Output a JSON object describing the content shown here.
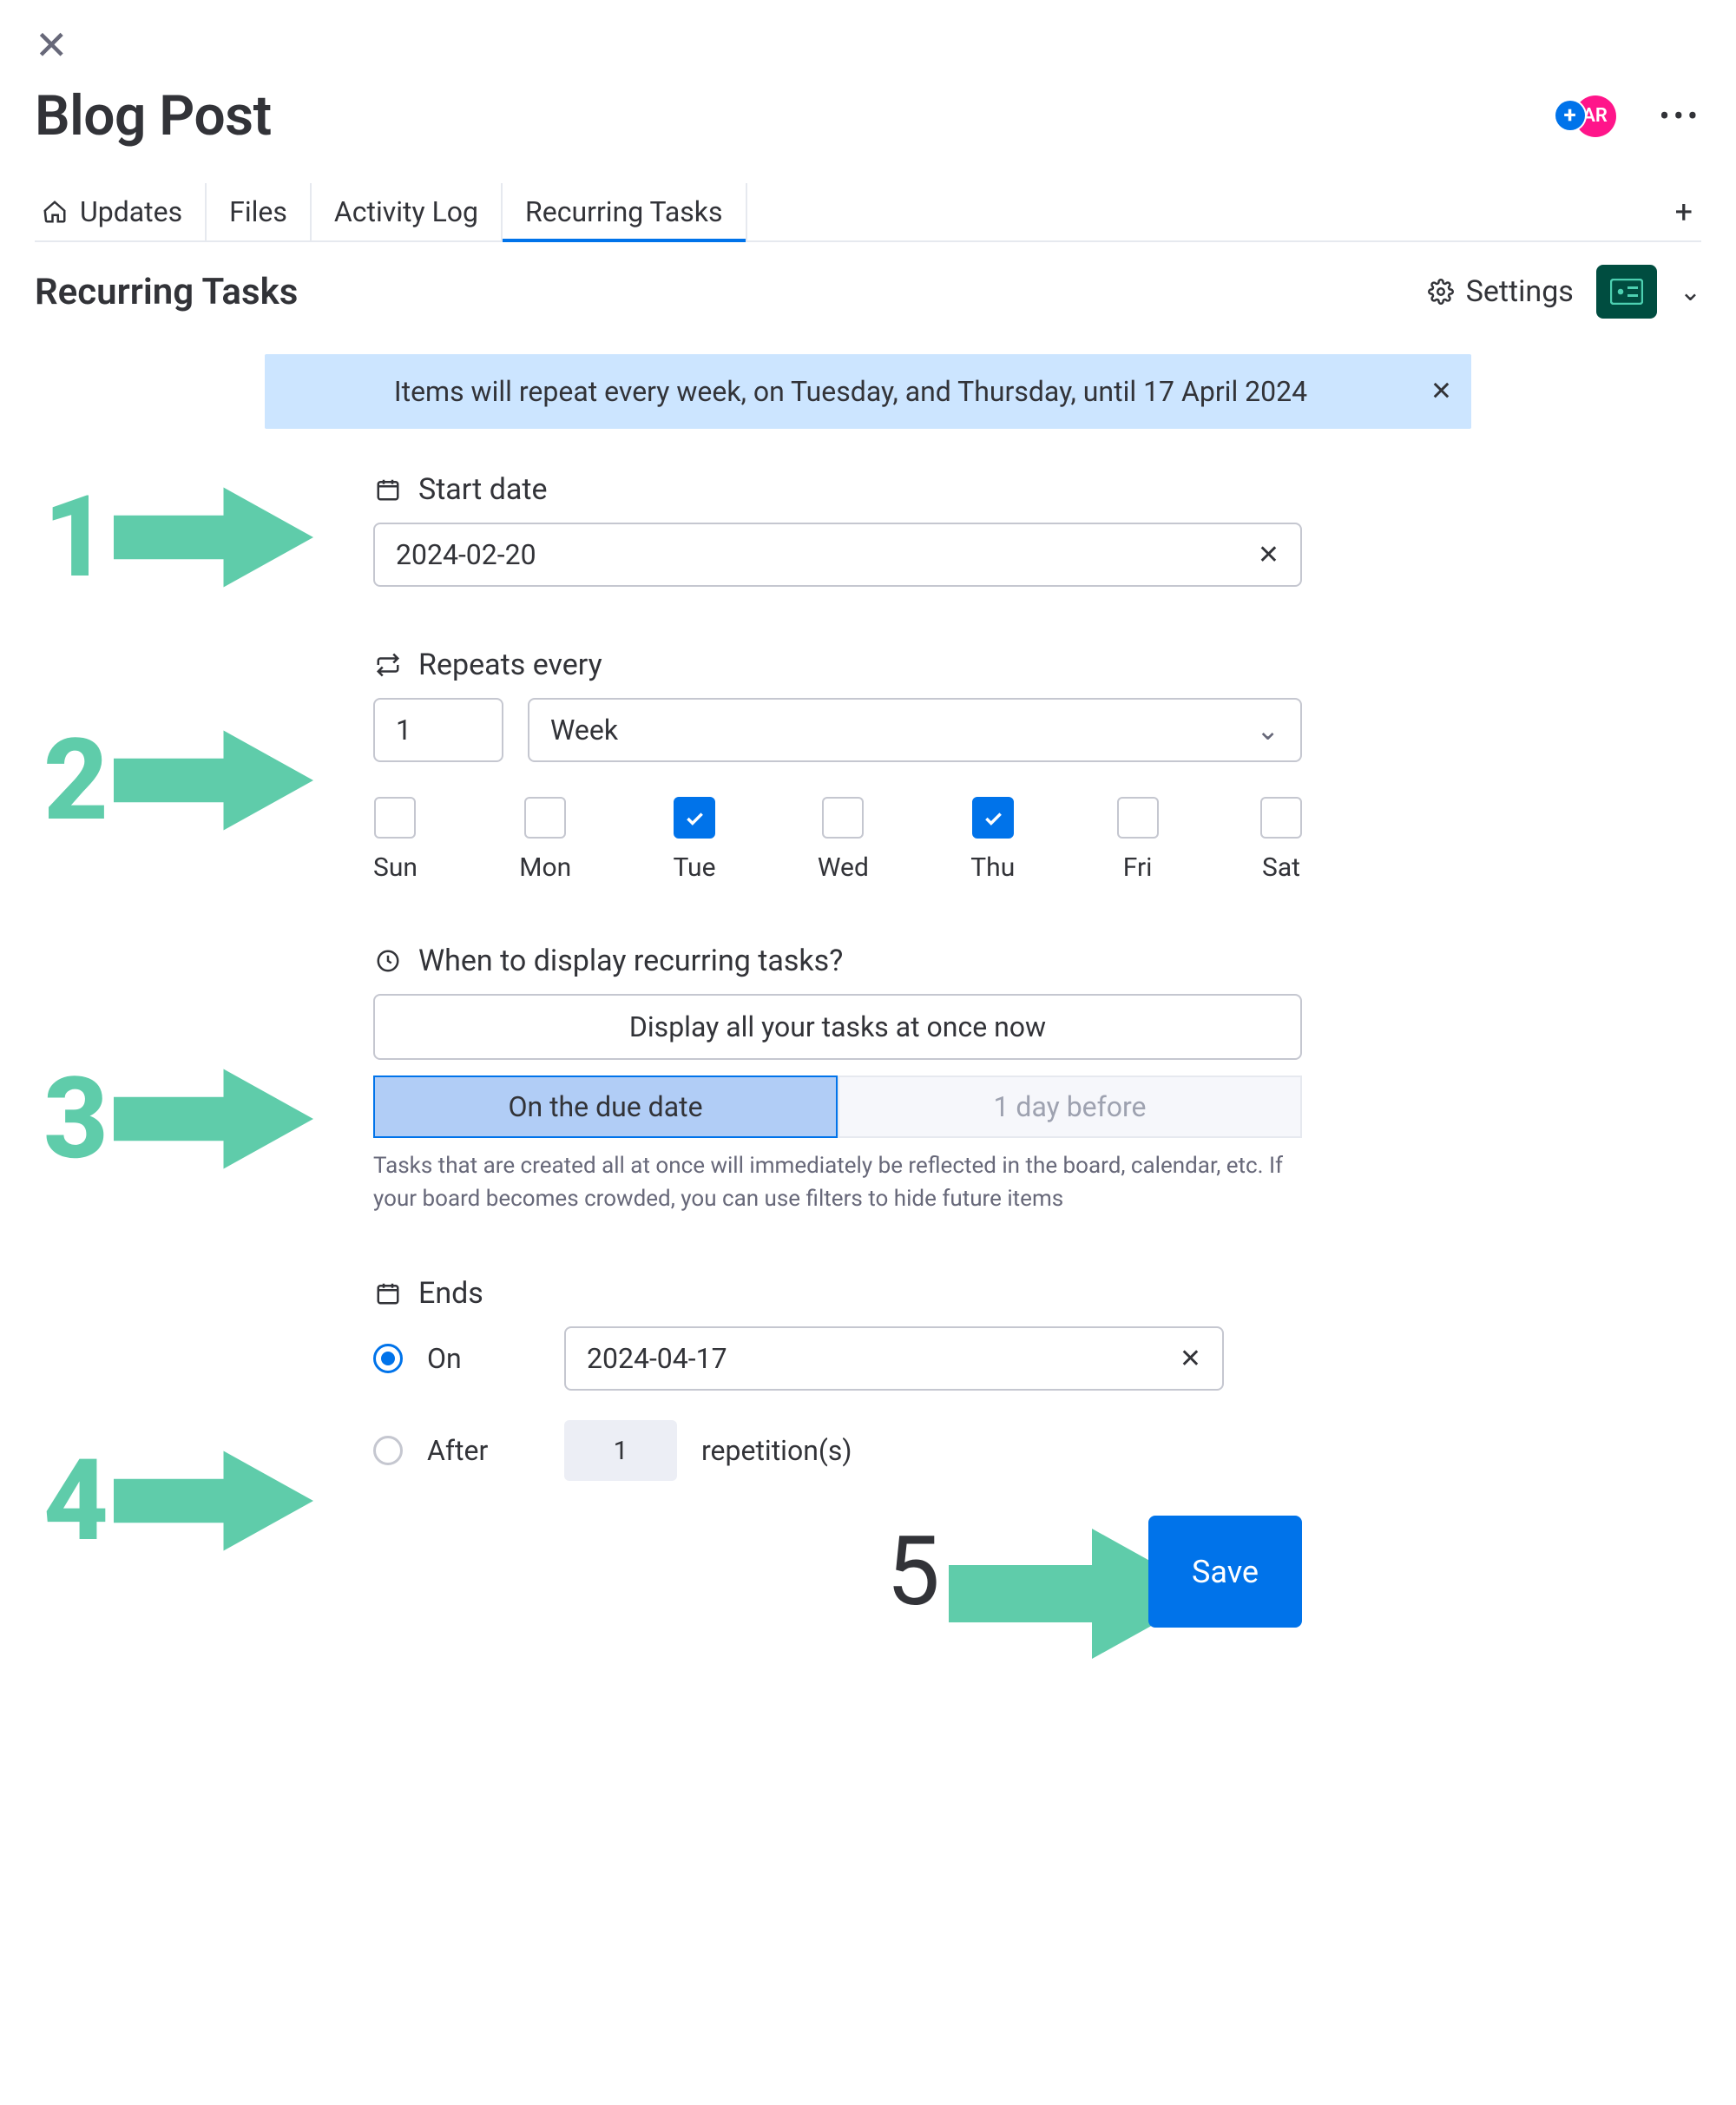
{
  "header": {
    "title": "Blog Post",
    "avatar_initials": "AR"
  },
  "tabs": {
    "updates": "Updates",
    "files": "Files",
    "activity_log": "Activity Log",
    "recurring": "Recurring Tasks"
  },
  "section": {
    "title": "Recurring Tasks",
    "settings": "Settings"
  },
  "banner": {
    "text": "Items will repeat every week, on Tuesday, and Thursday, until 17 April 2024"
  },
  "form": {
    "start_date": {
      "label": "Start date",
      "value": "2024-02-20"
    },
    "repeats": {
      "label": "Repeats every",
      "interval": "1",
      "unit": "Week",
      "days": {
        "sun": "Sun",
        "mon": "Mon",
        "tue": "Tue",
        "wed": "Wed",
        "thu": "Thu",
        "fri": "Fri",
        "sat": "Sat"
      }
    },
    "display": {
      "label": "When to display recurring tasks?",
      "all_now": "Display all your tasks at once now",
      "on_due": "On the due date",
      "one_before": "1 day before",
      "help": "Tasks that are created all at once will immediately be reflected in the board, calendar, etc. If your board becomes crowded, you can use filters to hide future items"
    },
    "ends": {
      "label": "Ends",
      "on": "On",
      "on_value": "2024-04-17",
      "after": "After",
      "after_count": "1",
      "reps": "repetition(s)"
    },
    "save": "Save"
  },
  "annotations": {
    "n1": "1",
    "n2": "2",
    "n3": "3",
    "n4": "4",
    "n5": "5"
  }
}
